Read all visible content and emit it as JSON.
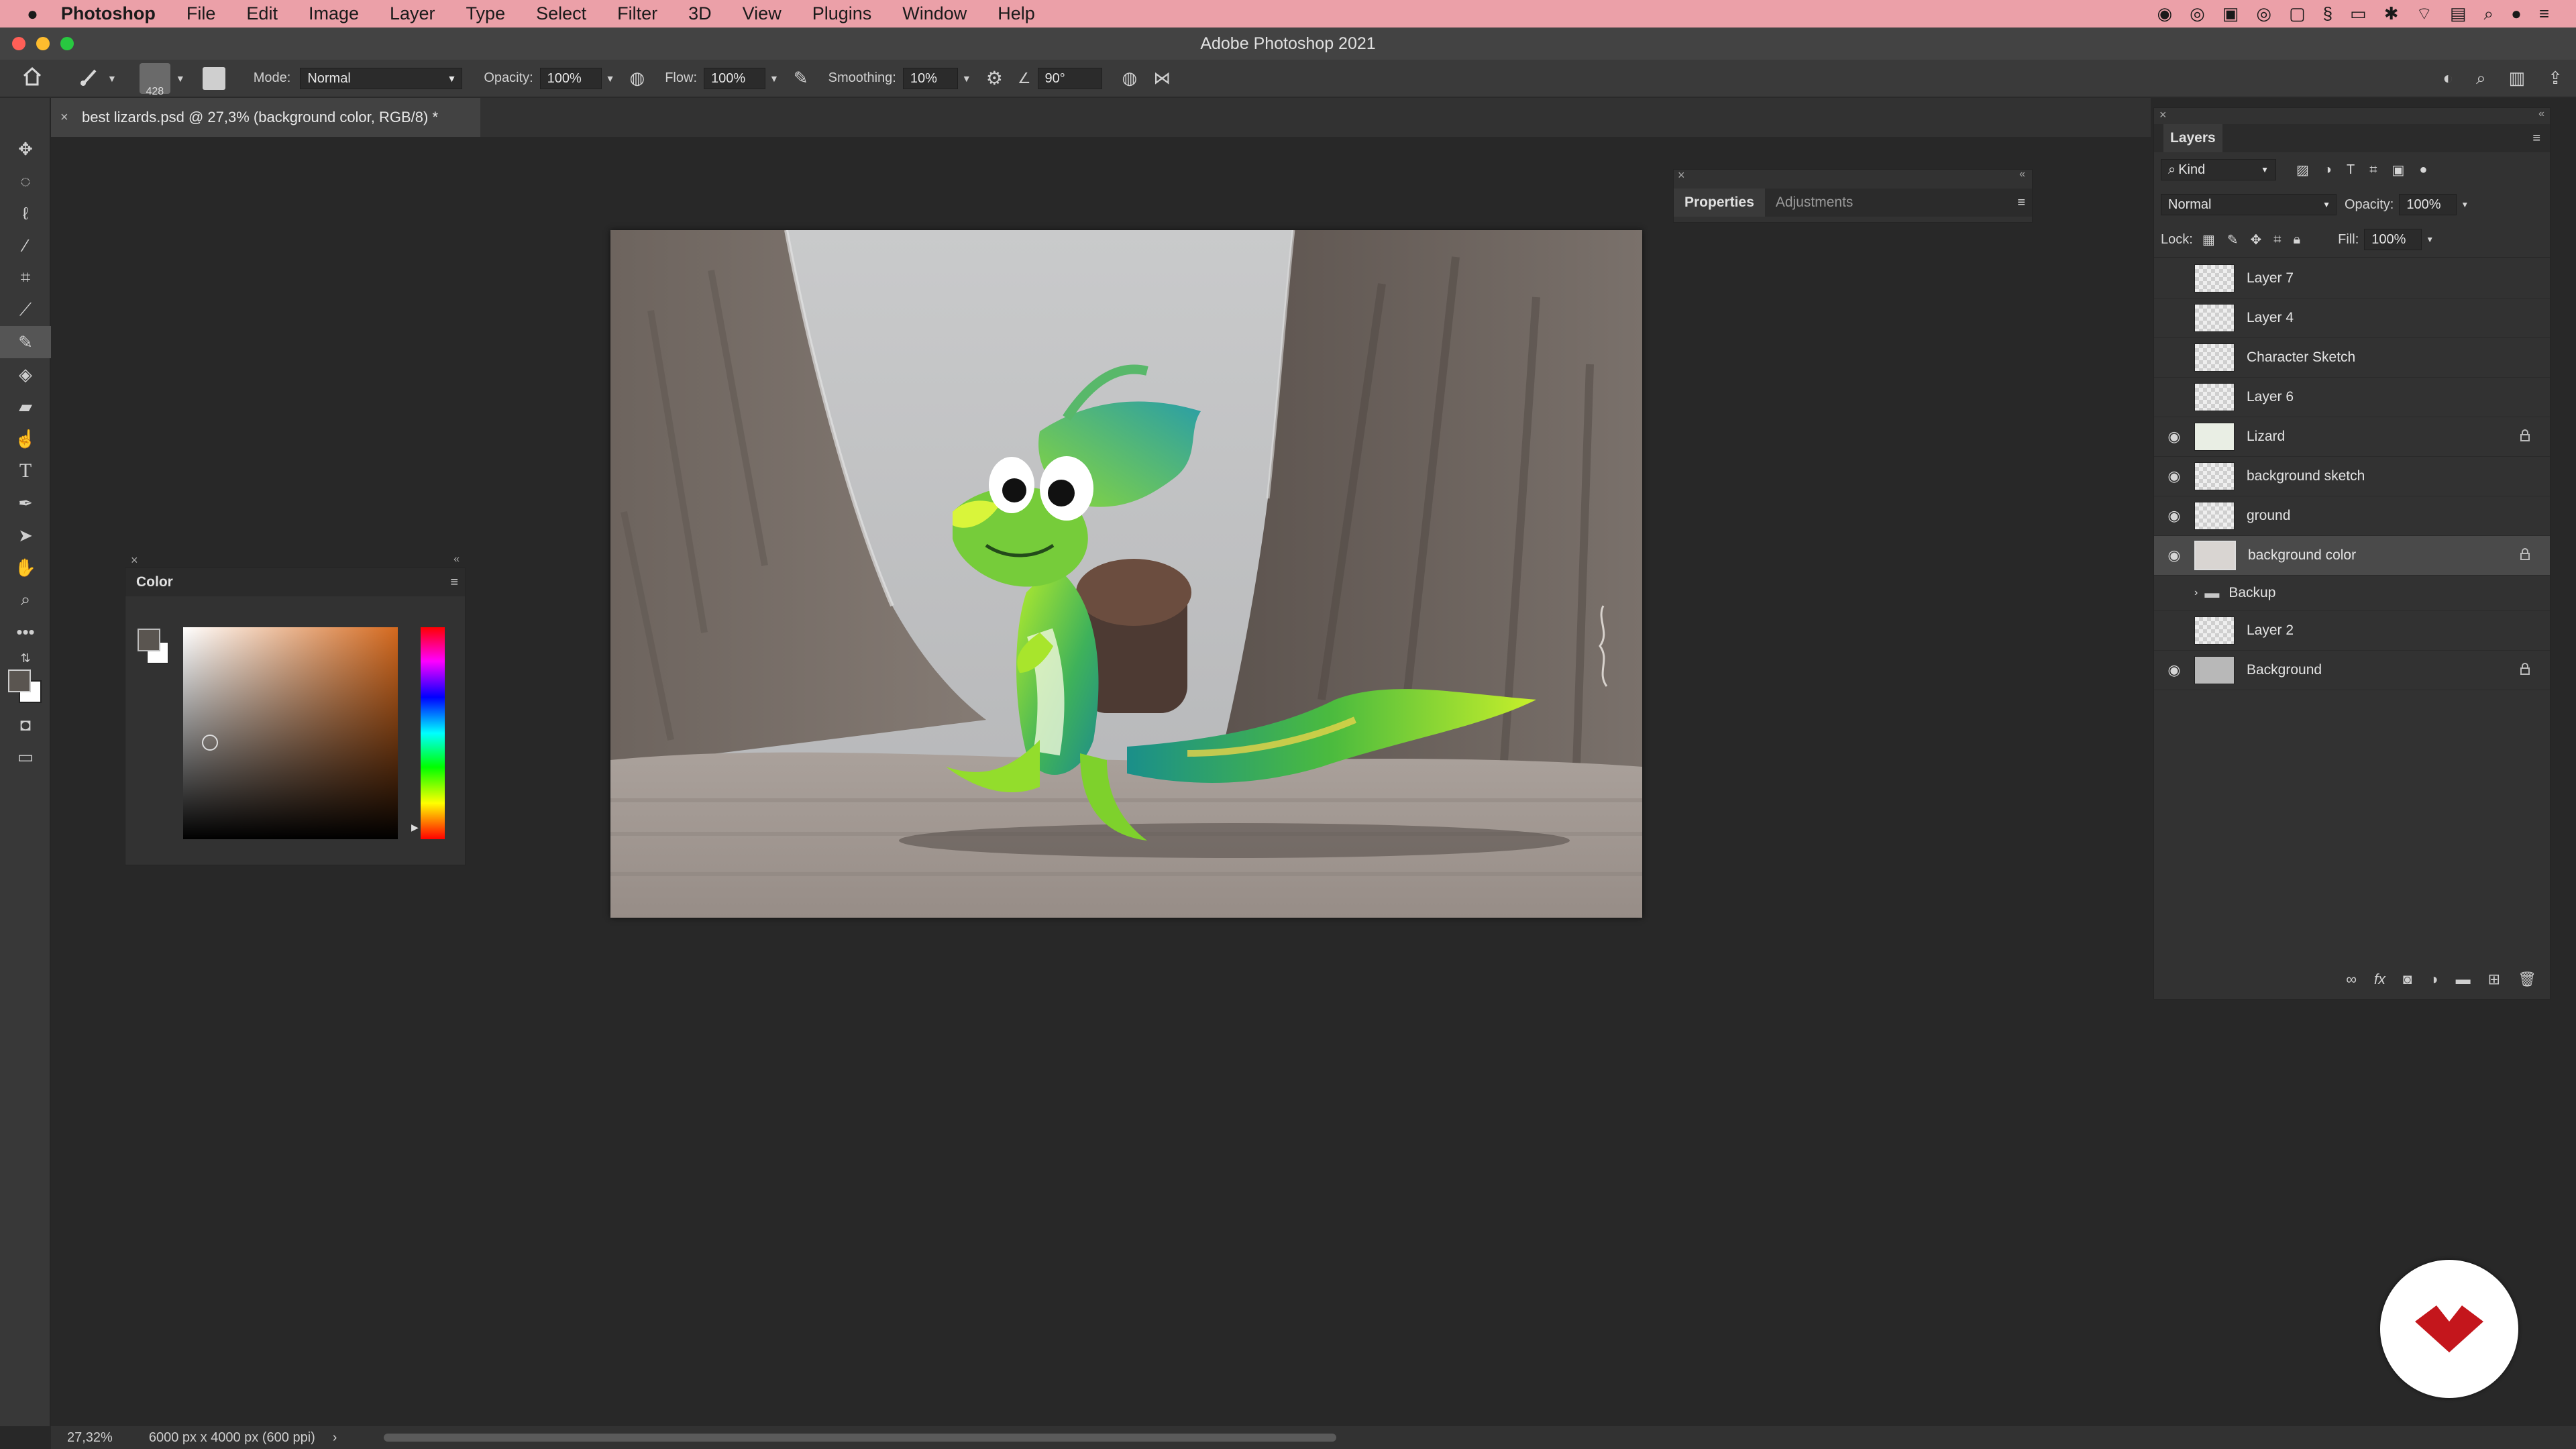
{
  "menubar": {
    "app_name": "Photoshop",
    "items": [
      "File",
      "Edit",
      "Image",
      "Layer",
      "Type",
      "Select",
      "Filter",
      "3D",
      "View",
      "Plugins",
      "Window",
      "Help"
    ]
  },
  "window": {
    "title": "Adobe Photoshop 2021"
  },
  "options_bar": {
    "brush_size": "428",
    "mode_label": "Mode:",
    "mode_value": "Normal",
    "opacity_label": "Opacity:",
    "opacity_value": "100%",
    "flow_label": "Flow:",
    "flow_value": "100%",
    "smoothing_label": "Smoothing:",
    "smoothing_value": "10%",
    "angle_value": "90°"
  },
  "document": {
    "tab_title": "best lizards.psd @ 27,3% (background color, RGB/8) *"
  },
  "color_panel": {
    "title": "Color",
    "base_hue_color": "#d4691e"
  },
  "properties_panel": {
    "tabs": [
      "Properties",
      "Adjustments"
    ]
  },
  "layers_panel": {
    "title": "Layers",
    "filter_kind": "Kind",
    "blend_mode": "Normal",
    "opacity_label": "Opacity:",
    "opacity_value": "100%",
    "lock_label": "Lock:",
    "fill_label": "Fill:",
    "fill_value": "100%",
    "layers": [
      {
        "name": "Layer 7",
        "visible": false,
        "locked": false,
        "selected": false
      },
      {
        "name": "Layer 4",
        "visible": false,
        "locked": false,
        "selected": false
      },
      {
        "name": "Character Sketch",
        "visible": false,
        "locked": false,
        "selected": false
      },
      {
        "name": "Layer 6",
        "visible": false,
        "locked": false,
        "selected": false
      },
      {
        "name": "Lizard",
        "visible": true,
        "locked": true,
        "selected": false
      },
      {
        "name": "background sketch",
        "visible": true,
        "locked": false,
        "selected": false
      },
      {
        "name": "ground",
        "visible": true,
        "locked": false,
        "selected": false
      },
      {
        "name": "background color",
        "visible": true,
        "locked": true,
        "selected": true
      },
      {
        "name": "Backup",
        "visible": false,
        "locked": false,
        "selected": false,
        "group": true
      },
      {
        "name": "Layer 2",
        "visible": false,
        "locked": false,
        "selected": false
      },
      {
        "name": "Background",
        "visible": true,
        "locked": true,
        "selected": false
      }
    ]
  },
  "status_bar": {
    "zoom": "27,32%",
    "doc_info": "6000 px x 4000 px (600 ppi)"
  },
  "colors": {
    "menubar": "#eba0a8",
    "logo_red": "#c4161c"
  }
}
